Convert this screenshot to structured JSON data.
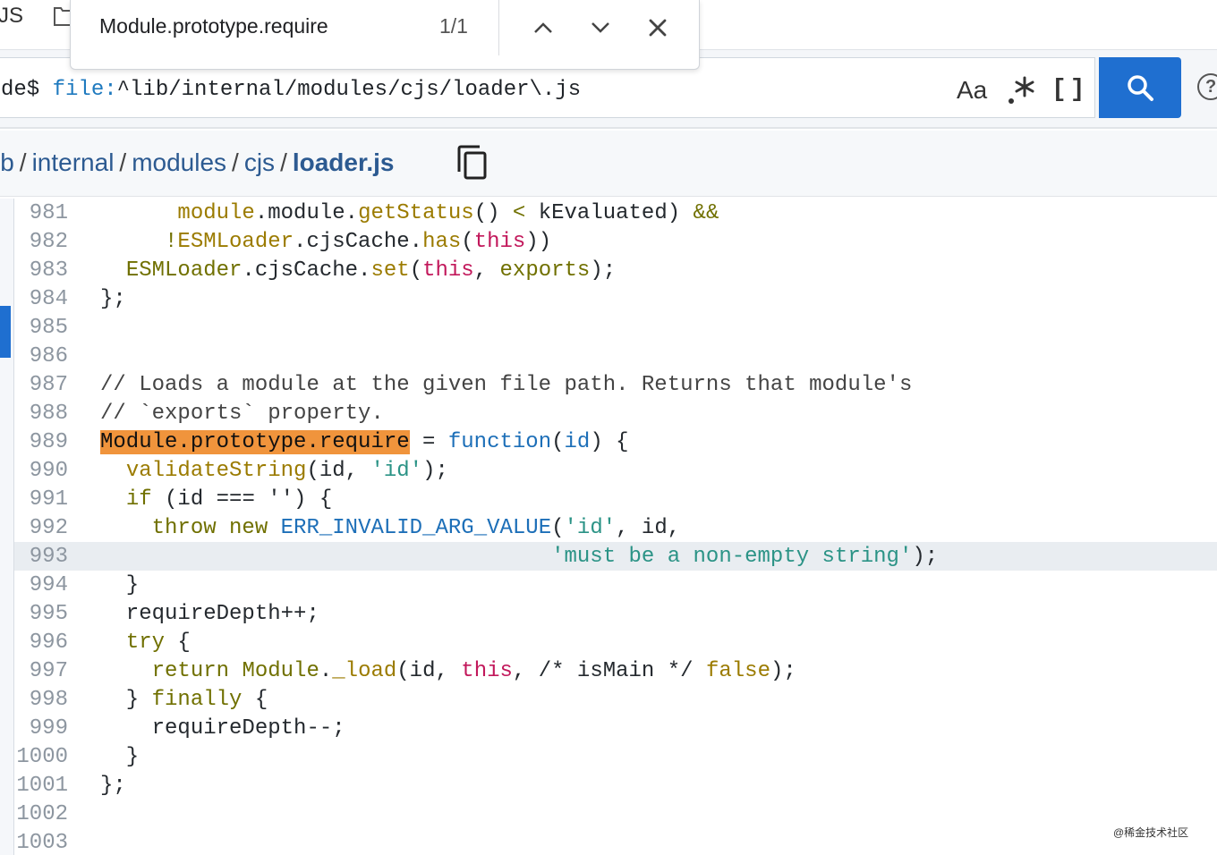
{
  "find_bar": {
    "query": "Module.prototype.require",
    "count": "1/1"
  },
  "top": {
    "lang_label": "JS"
  },
  "search": {
    "prefix": "de$ ",
    "keyword": "file:",
    "pattern": "^lib/internal/modules/cjs/loader\\.js",
    "case_label": "Aa",
    "structural_label": "[]"
  },
  "breadcrumb": {
    "parts": [
      "ib",
      "internal",
      "modules",
      "cjs"
    ],
    "separator": "/",
    "current": "loader.js"
  },
  "code": {
    "active_line": "993",
    "lines": [
      {
        "n": "981",
        "tokens": [
          {
            "t": "      "
          },
          {
            "t": "module",
            "c": "f"
          },
          {
            "t": ".module."
          },
          {
            "t": "getStatus",
            "c": "f"
          },
          {
            "t": "() "
          },
          {
            "t": "<",
            "c": "k"
          },
          {
            "t": " kEvaluated) "
          },
          {
            "t": "&&",
            "c": "k"
          }
        ]
      },
      {
        "n": "982",
        "tokens": [
          {
            "t": "     "
          },
          {
            "t": "!",
            "c": "k"
          },
          {
            "t": "ESMLoader",
            "c": "f"
          },
          {
            "t": ".cjsCache."
          },
          {
            "t": "has",
            "c": "f"
          },
          {
            "t": "("
          },
          {
            "t": "this",
            "c": "t"
          },
          {
            "t": "))"
          }
        ]
      },
      {
        "n": "983",
        "tokens": [
          {
            "t": "  "
          },
          {
            "t": "ESMLoader",
            "c": "k"
          },
          {
            "t": ".cjsCache."
          },
          {
            "t": "set",
            "c": "f"
          },
          {
            "t": "("
          },
          {
            "t": "this",
            "c": "t"
          },
          {
            "t": ", "
          },
          {
            "t": "exports",
            "c": "k"
          },
          {
            "t": ");"
          }
        ]
      },
      {
        "n": "984",
        "tokens": [
          {
            "t": "};"
          }
        ]
      },
      {
        "n": "985",
        "tokens": []
      },
      {
        "n": "986",
        "tokens": []
      },
      {
        "n": "987",
        "tokens": [
          {
            "t": "// Loads a module at the given file path. Returns that module's",
            "c": "c"
          }
        ]
      },
      {
        "n": "988",
        "tokens": [
          {
            "t": "// `exports` property.",
            "c": "c"
          }
        ]
      },
      {
        "n": "989",
        "tokens": [
          {
            "t": "Module.prototype.require",
            "c": "hl"
          },
          {
            "t": " = "
          },
          {
            "t": "function",
            "c": "b"
          },
          {
            "t": "("
          },
          {
            "t": "id",
            "c": "b"
          },
          {
            "t": ") {"
          }
        ]
      },
      {
        "n": "990",
        "tokens": [
          {
            "t": "  "
          },
          {
            "t": "validateString",
            "c": "f"
          },
          {
            "t": "(id, "
          },
          {
            "t": "'id'",
            "c": "s"
          },
          {
            "t": ");"
          }
        ]
      },
      {
        "n": "991",
        "tokens": [
          {
            "t": "  "
          },
          {
            "t": "if",
            "c": "k"
          },
          {
            "t": " (id === '') {"
          }
        ]
      },
      {
        "n": "992",
        "tokens": [
          {
            "t": "    "
          },
          {
            "t": "throw",
            "c": "k"
          },
          {
            "t": " "
          },
          {
            "t": "new",
            "c": "k"
          },
          {
            "t": " "
          },
          {
            "t": "ERR_INVALID_ARG_VALUE",
            "c": "b"
          },
          {
            "t": "("
          },
          {
            "t": "'id'",
            "c": "s"
          },
          {
            "t": ", id,"
          }
        ]
      },
      {
        "n": "993",
        "tokens": [
          {
            "t": "                                   "
          },
          {
            "t": "'must be a non-empty string'",
            "c": "s"
          },
          {
            "t": ");"
          }
        ]
      },
      {
        "n": "994",
        "tokens": [
          {
            "t": "  }"
          }
        ]
      },
      {
        "n": "995",
        "tokens": [
          {
            "t": "  requireDepth++;"
          }
        ]
      },
      {
        "n": "996",
        "tokens": [
          {
            "t": "  "
          },
          {
            "t": "try",
            "c": "k"
          },
          {
            "t": " {"
          }
        ]
      },
      {
        "n": "997",
        "tokens": [
          {
            "t": "    "
          },
          {
            "t": "return",
            "c": "k"
          },
          {
            "t": " "
          },
          {
            "t": "Module",
            "c": "k"
          },
          {
            "t": "."
          },
          {
            "t": "_load",
            "c": "f"
          },
          {
            "t": "(id, "
          },
          {
            "t": "this",
            "c": "t"
          },
          {
            "t": ", /* isMain */ "
          },
          {
            "t": "false",
            "c": "f"
          },
          {
            "t": ");"
          }
        ]
      },
      {
        "n": "998",
        "tokens": [
          {
            "t": "  } "
          },
          {
            "t": "finally",
            "c": "k"
          },
          {
            "t": " {"
          }
        ]
      },
      {
        "n": "999",
        "tokens": [
          {
            "t": "    requireDepth--;"
          }
        ]
      },
      {
        "n": "1000",
        "tokens": [
          {
            "t": "  }"
          }
        ]
      },
      {
        "n": "1001",
        "tokens": [
          {
            "t": "};"
          }
        ]
      },
      {
        "n": "1002",
        "tokens": []
      },
      {
        "n": "1003",
        "tokens": []
      }
    ]
  },
  "watermark": "@稀金技术社区",
  "icons": {
    "folder": "folder-icon",
    "search": "search-icon",
    "copy": "copy-icon",
    "prev": "chevron-up-icon",
    "next": "chevron-down-icon",
    "close": "close-icon",
    "help": "help-icon",
    "regex": "regex-icon"
  },
  "colors": {
    "accent": "#1f6fd0",
    "match_highlight": "#f0943c"
  }
}
